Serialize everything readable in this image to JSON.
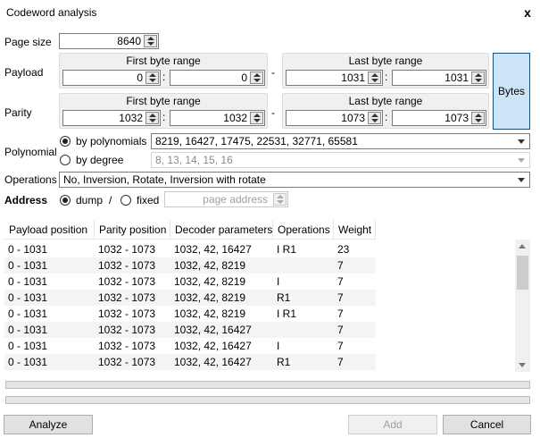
{
  "window": {
    "title": "Codeword analysis",
    "close": "x"
  },
  "page_size": {
    "label": "Page size",
    "value": "8640"
  },
  "payload": {
    "label": "Payload",
    "first": {
      "title": "First byte range",
      "from": "0",
      "to": "0"
    },
    "last": {
      "title": "Last byte range",
      "from": "1031",
      "to": "1031"
    }
  },
  "parity": {
    "label": "Parity",
    "first": {
      "title": "First byte range",
      "from": "1032",
      "to": "1032"
    },
    "last": {
      "title": "Last byte range",
      "from": "1073",
      "to": "1073"
    }
  },
  "separators": {
    "colon": ":",
    "dash": "-"
  },
  "bytes_button": "Bytes",
  "polynomial": {
    "label": "Polynomial",
    "by_poly_label": "by polynomials",
    "by_poly_value": "8219, 16427, 17475, 22531, 32771, 65581",
    "by_degree_label": "by degree",
    "by_degree_value": "8, 13, 14, 15, 16"
  },
  "operations": {
    "label": "Operations",
    "value": "No, Inversion, Rotate, Inversion with rotate"
  },
  "address": {
    "label": "Address",
    "dump_label": "dump",
    "slash": "/",
    "fixed_label": "fixed",
    "placeholder": "page address"
  },
  "table": {
    "headers": [
      "Payload position",
      "Parity position",
      "Decoder parameters",
      "Operations",
      "Weight"
    ],
    "rows": [
      [
        "0 - 1031",
        "1032 - 1073",
        "1032, 42, 16427",
        "I R1",
        "23"
      ],
      [
        "0 - 1031",
        "1032 - 1073",
        "1032, 42, 8219",
        "",
        "7"
      ],
      [
        "0 - 1031",
        "1032 - 1073",
        "1032, 42, 8219",
        "I",
        "7"
      ],
      [
        "0 - 1031",
        "1032 - 1073",
        "1032, 42, 8219",
        "R1",
        "7"
      ],
      [
        "0 - 1031",
        "1032 - 1073",
        "1032, 42, 8219",
        "I R1",
        "7"
      ],
      [
        "0 - 1031",
        "1032 - 1073",
        "1032, 42, 16427",
        "",
        "7"
      ],
      [
        "0 - 1031",
        "1032 - 1073",
        "1032, 42, 16427",
        "I",
        "7"
      ],
      [
        "0 - 1031",
        "1032 - 1073",
        "1032, 42, 16427",
        "R1",
        "7"
      ]
    ]
  },
  "buttons": {
    "analyze": "Analyze",
    "add": "Add",
    "cancel": "Cancel"
  },
  "colors": {
    "accent": "#cce4f7",
    "accent_border": "#005499"
  }
}
